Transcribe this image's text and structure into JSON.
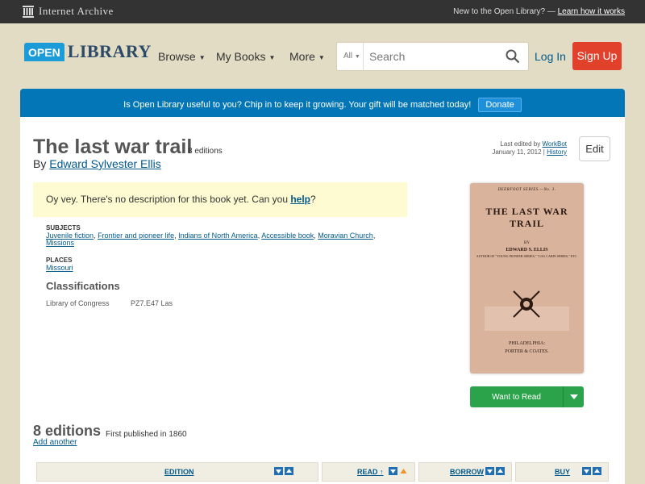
{
  "ia_bar": {
    "logo_text": "Internet Archive",
    "new_text": "New to the Open Library? —",
    "learn_link": "Learn how it works"
  },
  "header": {
    "logo_open": "OPEN",
    "logo_library": "LIBRARY",
    "nav": [
      {
        "label": "Browse"
      },
      {
        "label": "My Books"
      },
      {
        "label": "More"
      }
    ],
    "search": {
      "scope": "All",
      "placeholder": "Search"
    },
    "login": "Log In",
    "signup": "Sign Up"
  },
  "donate": {
    "text": "Is Open Library useful to you? Chip in to keep it growing. Your gift will be matched today!",
    "button": "Donate"
  },
  "book": {
    "title": "The last war trail",
    "editions_count": "8 editions",
    "by": "By",
    "author": "Edward Sylvester Ellis",
    "last_edited_prefix": "Last edited by",
    "last_edited_user": "WorkBot",
    "last_edited_date": "January 11, 2012 |",
    "history_link": "History",
    "edit_button": "Edit",
    "no_description_prefix": "Oy vey. There's no description for this book yet. Can you",
    "no_description_link": "help",
    "no_description_suffix": "?",
    "subjects_heading": "SUBJECTS",
    "subjects": [
      "Juvenile fiction",
      "Frontier and pioneer life",
      "Indians of North America",
      "Accessible book",
      "Moravian Church",
      "Missions"
    ],
    "places_heading": "PLACES",
    "places": [
      "Missouri"
    ],
    "classifications_heading": "Classifications",
    "classification_label": "Library of Congress",
    "classification_value": "PZ7.E47 Las"
  },
  "cover": {
    "series": "DEERFOOT SERIES.—No. 3.",
    "title": "THE LAST WAR TRAIL",
    "by": "BY",
    "author": "EDWARD S. ELLIS",
    "author_note": "AUTHOR OF \"YOUNG PIONEER SERIES,\" \"LOG CABIN SERIES,\" ETC.",
    "city": "PHILADELPHIA:",
    "publisher": "PORTER & COATES."
  },
  "want_to_read": "Want to Read",
  "editions_section": {
    "heading": "8 editions",
    "first_published": "First published in 1860",
    "add_another": "Add another",
    "columns": [
      "EDITION",
      "READ ↑",
      "BORROW",
      "BUY"
    ]
  },
  "colors": {
    "page_bg": "#e2dcc5",
    "donate_bar": "#0376b8",
    "signup": "#e1412b",
    "want_to_read": "#2aa34a",
    "link": "#02598b"
  }
}
